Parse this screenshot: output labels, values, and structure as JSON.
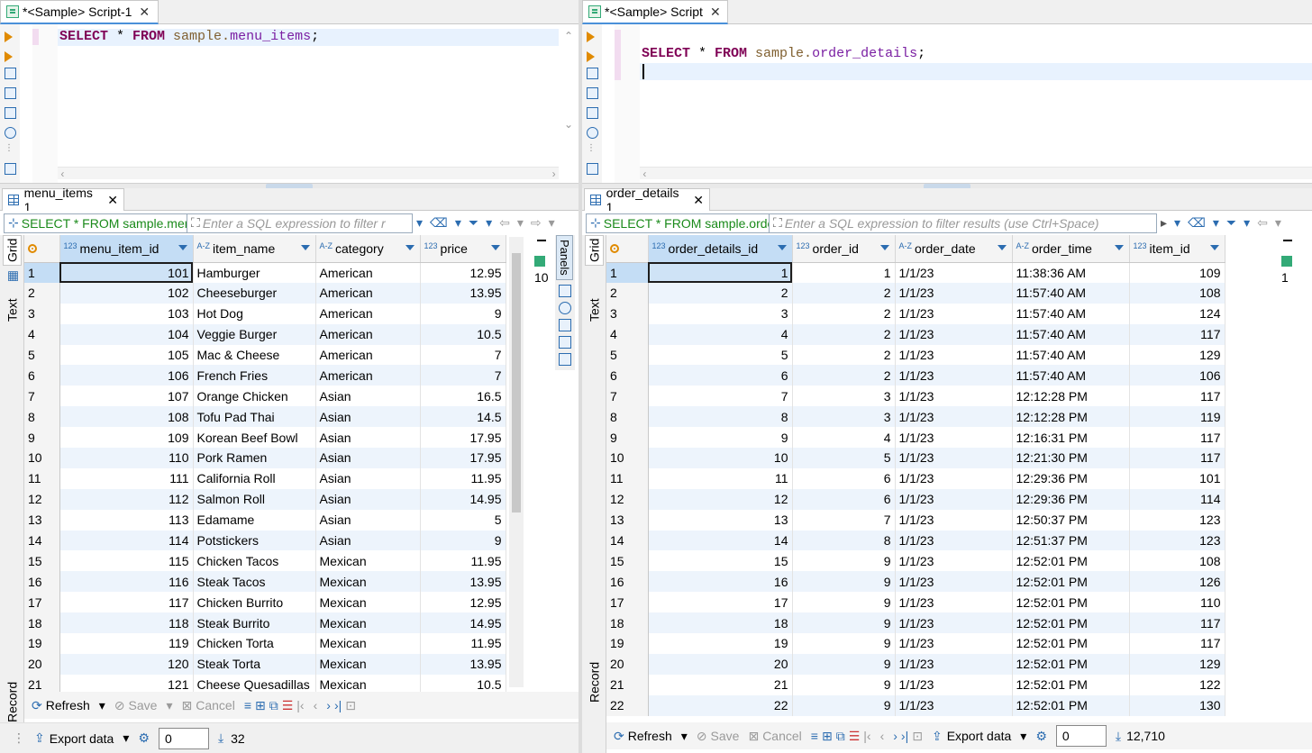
{
  "left": {
    "tab": {
      "title": "*<Sample> Script-1",
      "close": "✕"
    },
    "editor": {
      "kw_select": "SELECT",
      "star": " * ",
      "kw_from": "FROM",
      "schema": " sample.",
      "table": "menu_items",
      "semi": ";"
    },
    "result_tab": {
      "title": "menu_items 1",
      "close": "✕"
    },
    "filter": {
      "query": "SELECT * FROM sample.menu",
      "placeholder": "Enter a SQL expression to filter r"
    },
    "side_tabs": {
      "grid": "Grid",
      "text": "Text",
      "record": "Record"
    },
    "panels_label": "Panels",
    "extra_value": "10",
    "columns": [
      "menu_item_id",
      "item_name",
      "category",
      "price"
    ],
    "column_types": [
      "123",
      "A-Z",
      "A-Z",
      "123"
    ],
    "rows": [
      [
        "1",
        "101",
        "Hamburger",
        "American",
        "12.95"
      ],
      [
        "2",
        "102",
        "Cheeseburger",
        "American",
        "13.95"
      ],
      [
        "3",
        "103",
        "Hot Dog",
        "American",
        "9"
      ],
      [
        "4",
        "104",
        "Veggie Burger",
        "American",
        "10.5"
      ],
      [
        "5",
        "105",
        "Mac & Cheese",
        "American",
        "7"
      ],
      [
        "6",
        "106",
        "French Fries",
        "American",
        "7"
      ],
      [
        "7",
        "107",
        "Orange Chicken",
        "Asian",
        "16.5"
      ],
      [
        "8",
        "108",
        "Tofu Pad Thai",
        "Asian",
        "14.5"
      ],
      [
        "9",
        "109",
        "Korean Beef Bowl",
        "Asian",
        "17.95"
      ],
      [
        "10",
        "110",
        "Pork Ramen",
        "Asian",
        "17.95"
      ],
      [
        "11",
        "111",
        "California Roll",
        "Asian",
        "11.95"
      ],
      [
        "12",
        "112",
        "Salmon Roll",
        "Asian",
        "14.95"
      ],
      [
        "13",
        "113",
        "Edamame",
        "Asian",
        "5"
      ],
      [
        "14",
        "114",
        "Potstickers",
        "Asian",
        "9"
      ],
      [
        "15",
        "115",
        "Chicken Tacos",
        "Mexican",
        "11.95"
      ],
      [
        "16",
        "116",
        "Steak Tacos",
        "Mexican",
        "13.95"
      ],
      [
        "17",
        "117",
        "Chicken Burrito",
        "Mexican",
        "12.95"
      ],
      [
        "18",
        "118",
        "Steak Burrito",
        "Mexican",
        "14.95"
      ],
      [
        "19",
        "119",
        "Chicken Torta",
        "Mexican",
        "11.95"
      ],
      [
        "20",
        "120",
        "Steak Torta",
        "Mexican",
        "13.95"
      ],
      [
        "21",
        "121",
        "Cheese Quesadillas",
        "Mexican",
        "10.5"
      ]
    ],
    "toolbar": {
      "refresh": "Refresh",
      "save": "Save",
      "cancel": "Cancel"
    },
    "status": {
      "export": "Export data",
      "offset": "0",
      "count": "32"
    }
  },
  "right": {
    "tab": {
      "title": "*<Sample> Script",
      "close": "✕"
    },
    "editor": {
      "kw_select": "SELECT",
      "star": " * ",
      "kw_from": "FROM",
      "schema": " sample.",
      "table": "order_details",
      "semi": ";"
    },
    "result_tab": {
      "title": "order_details 1",
      "close": "✕"
    },
    "filter": {
      "query": "SELECT * FROM sample.orde",
      "placeholder": "Enter a SQL expression to filter results (use Ctrl+Space)"
    },
    "side_tabs": {
      "grid": "Grid",
      "text": "Text",
      "record": "Record"
    },
    "extra_value": "1",
    "columns": [
      "order_details_id",
      "order_id",
      "order_date",
      "order_time",
      "item_id"
    ],
    "column_types": [
      "123",
      "123",
      "A-Z",
      "A-Z",
      "123"
    ],
    "rows": [
      [
        "1",
        "1",
        "1",
        "1/1/23",
        "11:38:36 AM",
        "109"
      ],
      [
        "2",
        "2",
        "2",
        "1/1/23",
        "11:57:40 AM",
        "108"
      ],
      [
        "3",
        "3",
        "2",
        "1/1/23",
        "11:57:40 AM",
        "124"
      ],
      [
        "4",
        "4",
        "2",
        "1/1/23",
        "11:57:40 AM",
        "117"
      ],
      [
        "5",
        "5",
        "2",
        "1/1/23",
        "11:57:40 AM",
        "129"
      ],
      [
        "6",
        "6",
        "2",
        "1/1/23",
        "11:57:40 AM",
        "106"
      ],
      [
        "7",
        "7",
        "3",
        "1/1/23",
        "12:12:28 PM",
        "117"
      ],
      [
        "8",
        "8",
        "3",
        "1/1/23",
        "12:12:28 PM",
        "119"
      ],
      [
        "9",
        "9",
        "4",
        "1/1/23",
        "12:16:31 PM",
        "117"
      ],
      [
        "10",
        "10",
        "5",
        "1/1/23",
        "12:21:30 PM",
        "117"
      ],
      [
        "11",
        "11",
        "6",
        "1/1/23",
        "12:29:36 PM",
        "101"
      ],
      [
        "12",
        "12",
        "6",
        "1/1/23",
        "12:29:36 PM",
        "114"
      ],
      [
        "13",
        "13",
        "7",
        "1/1/23",
        "12:50:37 PM",
        "123"
      ],
      [
        "14",
        "14",
        "8",
        "1/1/23",
        "12:51:37 PM",
        "123"
      ],
      [
        "15",
        "15",
        "9",
        "1/1/23",
        "12:52:01 PM",
        "108"
      ],
      [
        "16",
        "16",
        "9",
        "1/1/23",
        "12:52:01 PM",
        "126"
      ],
      [
        "17",
        "17",
        "9",
        "1/1/23",
        "12:52:01 PM",
        "110"
      ],
      [
        "18",
        "18",
        "9",
        "1/1/23",
        "12:52:01 PM",
        "117"
      ],
      [
        "19",
        "19",
        "9",
        "1/1/23",
        "12:52:01 PM",
        "117"
      ],
      [
        "20",
        "20",
        "9",
        "1/1/23",
        "12:52:01 PM",
        "129"
      ],
      [
        "21",
        "21",
        "9",
        "1/1/23",
        "12:52:01 PM",
        "122"
      ],
      [
        "22",
        "22",
        "9",
        "1/1/23",
        "12:52:01 PM",
        "130"
      ]
    ],
    "toolbar": {
      "refresh": "Refresh",
      "save": "Save",
      "cancel": "Cancel"
    },
    "status": {
      "export": "Export data",
      "offset": "0",
      "count": "12,710"
    }
  },
  "colors": {
    "keyword": "#7f0055",
    "table": "#7a1fa2",
    "accent": "#2b6cb0",
    "query_text": "#1a8a1a",
    "stripe": "#edf4fc"
  }
}
